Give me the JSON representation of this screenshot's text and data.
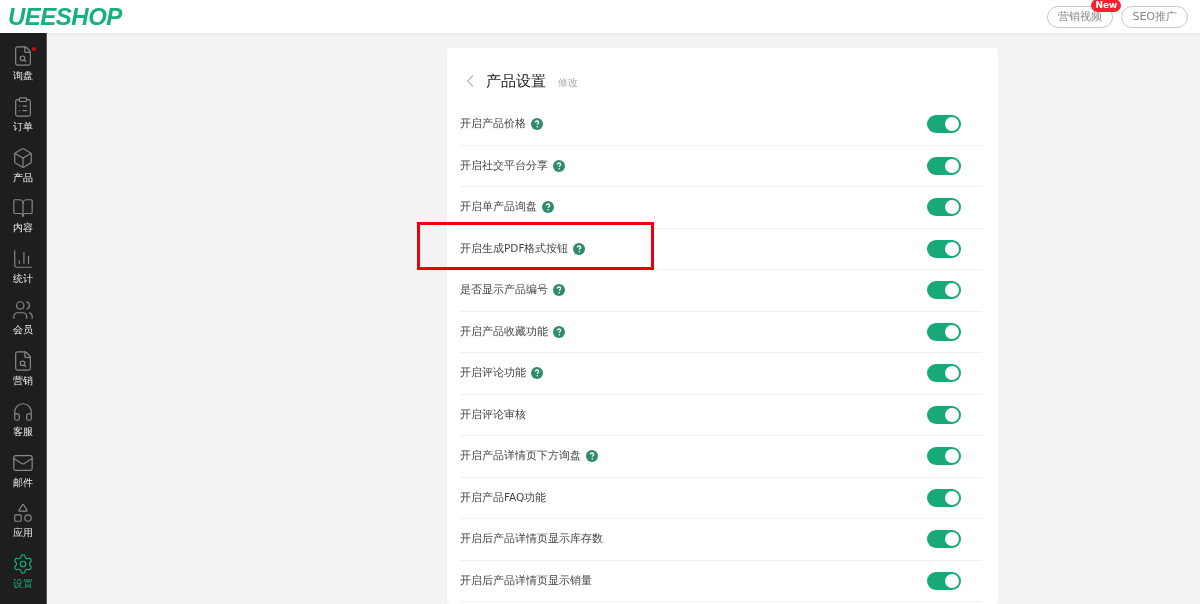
{
  "header": {
    "logo": "UEESHOP",
    "buttons": [
      {
        "label": "营销视频",
        "badge": "New"
      },
      {
        "label": "SEO推广"
      }
    ]
  },
  "sidebar": {
    "items": [
      {
        "label": "询盘",
        "selected": false,
        "notify": true
      },
      {
        "label": "订单",
        "selected": false,
        "notify": false
      },
      {
        "label": "产品",
        "selected": false,
        "notify": false
      },
      {
        "label": "内容",
        "selected": false,
        "notify": false
      },
      {
        "label": "统计",
        "selected": false,
        "notify": false
      },
      {
        "label": "会员",
        "selected": false,
        "notify": false
      },
      {
        "label": "营销",
        "selected": false,
        "notify": false
      },
      {
        "label": "客服",
        "selected": false,
        "notify": false
      },
      {
        "label": "邮件",
        "selected": false,
        "notify": false
      },
      {
        "label": "应用",
        "selected": false,
        "notify": false
      },
      {
        "label": "设置",
        "selected": true,
        "notify": false
      }
    ]
  },
  "panel": {
    "title": "产品设置",
    "edit_link": "修改",
    "settings": [
      {
        "label": "开启产品价格",
        "help": true,
        "on": true,
        "highlighted": false
      },
      {
        "label": "开启社交平台分享",
        "help": true,
        "on": true,
        "highlighted": false
      },
      {
        "label": "开启单产品询盘",
        "help": true,
        "on": true,
        "highlighted": false
      },
      {
        "label": "开启生成PDF格式按钮",
        "help": true,
        "on": true,
        "highlighted": true
      },
      {
        "label": "是否显示产品编号",
        "help": true,
        "on": true,
        "highlighted": false
      },
      {
        "label": "开启产品收藏功能",
        "help": true,
        "on": true,
        "highlighted": false
      },
      {
        "label": "开启评论功能",
        "help": true,
        "on": true,
        "highlighted": false
      },
      {
        "label": "开启评论审核",
        "help": false,
        "on": true,
        "highlighted": false
      },
      {
        "label": "开启产品详情页下方询盘",
        "help": true,
        "on": true,
        "highlighted": false
      },
      {
        "label": "开启产品FAQ功能",
        "help": false,
        "on": true,
        "highlighted": false
      },
      {
        "label": "开启后产品详情页显示库存数",
        "help": false,
        "on": true,
        "highlighted": false
      },
      {
        "label": "开启后产品详情页显示销量",
        "help": false,
        "on": true,
        "highlighted": false
      }
    ]
  }
}
